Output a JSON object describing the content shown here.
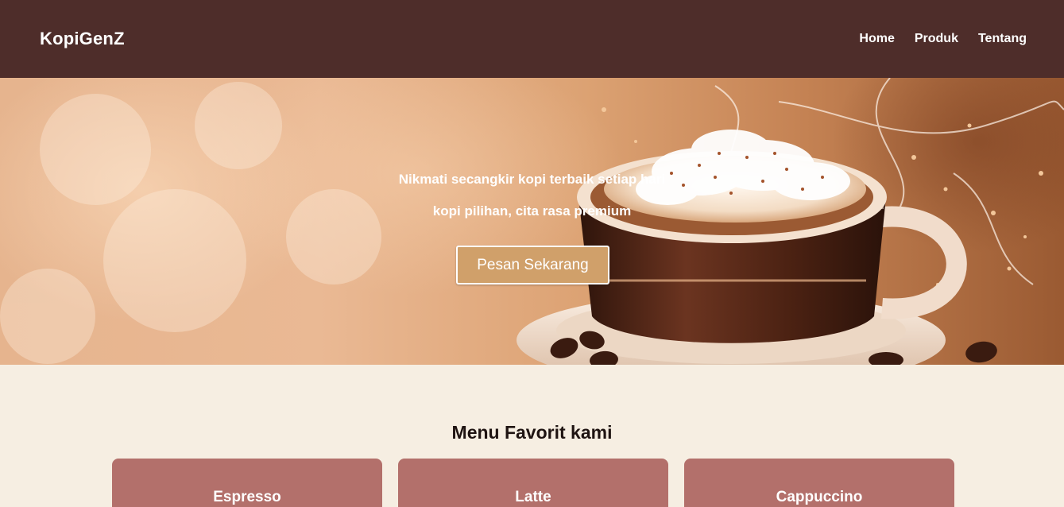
{
  "navbar": {
    "brand": "KopiGenZ",
    "links": [
      "Home",
      "Produk",
      "Tentang"
    ]
  },
  "hero": {
    "line1": "Nikmati secangkir kopi terbaik setiap hari",
    "line2": "kopi pilihan, cita rasa premium",
    "button_label": "Pesan Sekarang"
  },
  "menu": {
    "title": "Menu Favorit kami",
    "items": [
      {
        "name": "Espresso"
      },
      {
        "name": "Latte"
      },
      {
        "name": "Cappuccino"
      }
    ]
  },
  "colors": {
    "navbar": "#4e2d2a",
    "button": "#d0a06a",
    "card": "#b3706b",
    "page_bg": "#f6eee2"
  }
}
